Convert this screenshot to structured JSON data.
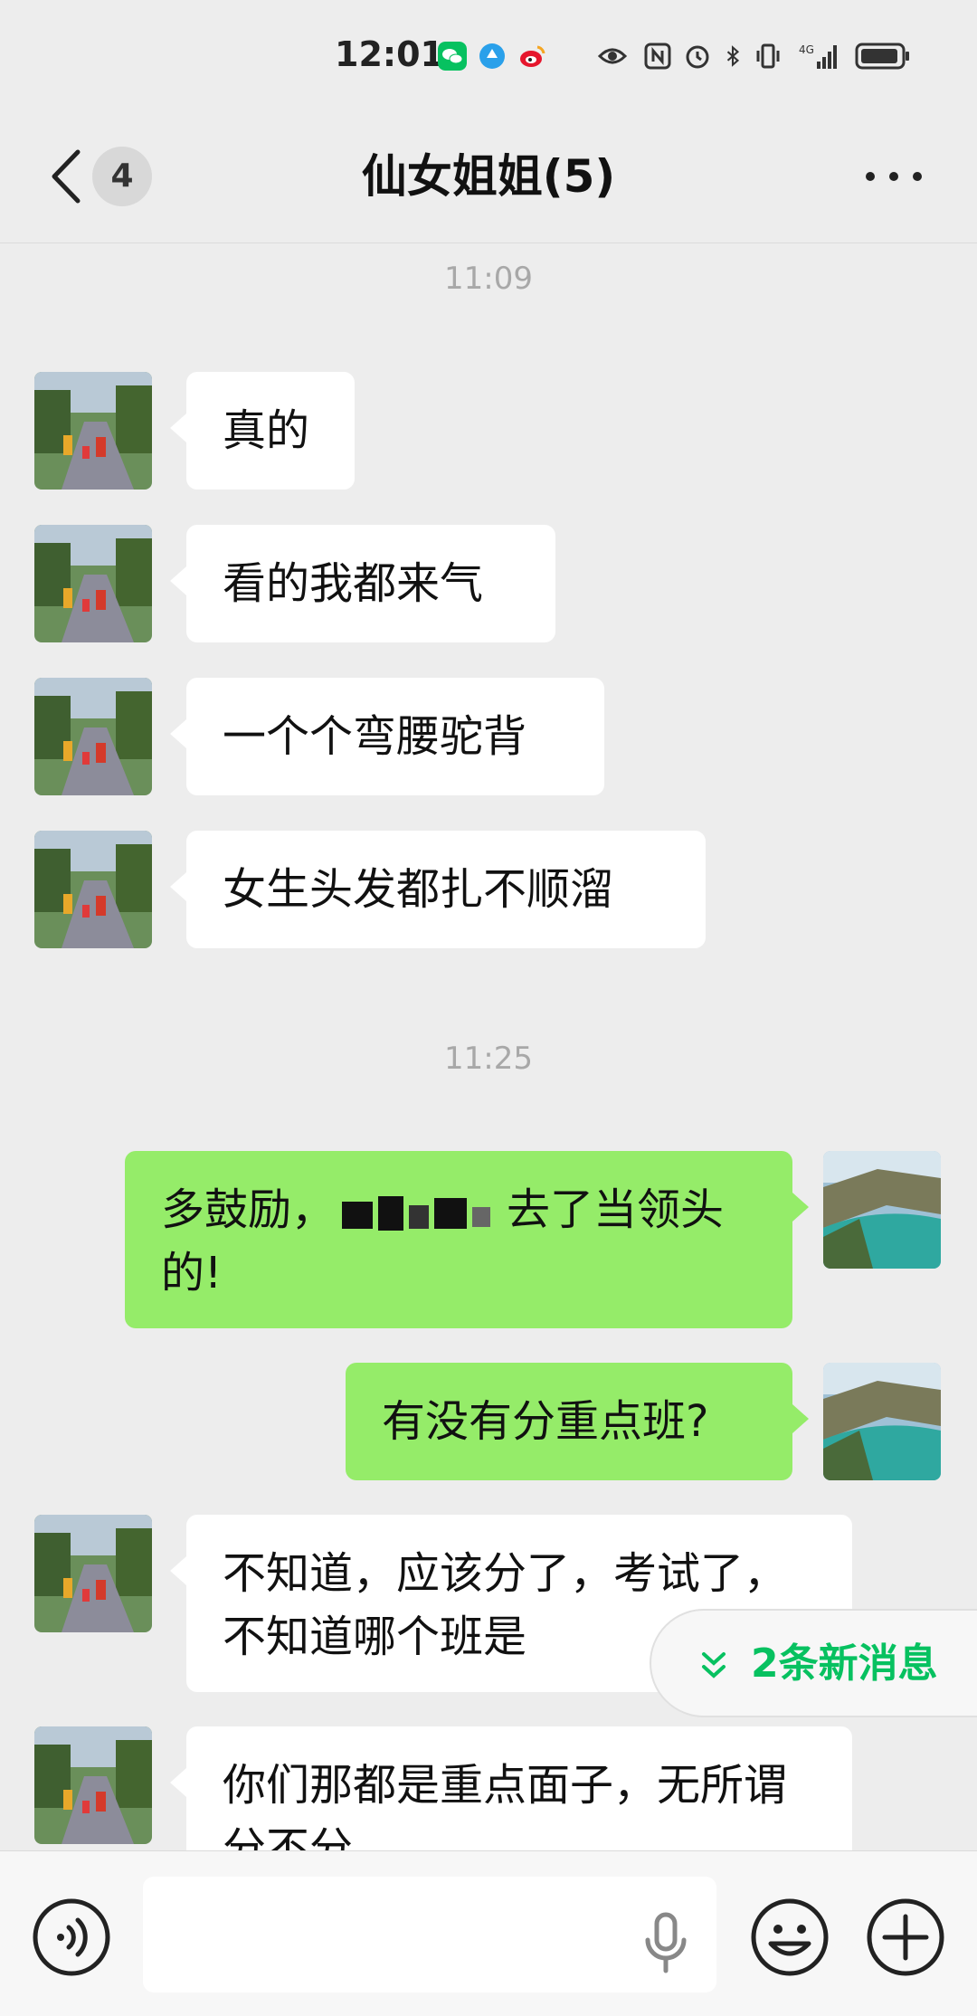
{
  "status_bar": {
    "time": "12:01",
    "network": "4G"
  },
  "header": {
    "back_count": "4",
    "title": "仙女姐姐(5)"
  },
  "timestamps": [
    "11:09",
    "11:25"
  ],
  "messages": [
    {
      "side": "in",
      "text": "真的"
    },
    {
      "side": "in",
      "text": "看的我都来气"
    },
    {
      "side": "in",
      "text": "一个个弯腰驼背"
    },
    {
      "side": "in",
      "text": "女生头发都扎不顺溜"
    },
    {
      "side": "out",
      "text_before": "多鼓励，",
      "text_after": "去了当领头的!"
    },
    {
      "side": "out",
      "text": "有没有分重点班?"
    },
    {
      "side": "in",
      "text": "不知道，应该分了，考试了，不知道哪个班是"
    },
    {
      "side": "in",
      "text": "你们那都是重点面子，无所谓分不分"
    }
  ],
  "new_messages_label": "2条新消息",
  "input": {
    "value": ""
  },
  "colors": {
    "background": "#ededed",
    "outgoing_bubble": "#95ec69",
    "incoming_bubble": "#ffffff",
    "accent": "#07c160"
  },
  "icons": [
    "back-arrow-icon",
    "more-icon",
    "voice-icon",
    "microphone-icon",
    "emoji-icon",
    "plus-icon",
    "chevron-down-icon"
  ]
}
